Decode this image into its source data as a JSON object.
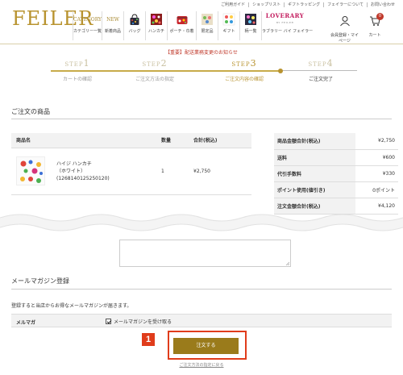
{
  "header": {
    "logo": "FEILER",
    "top_links": [
      "ご利用ガイド",
      "ショップリスト",
      "ギフトラッピング",
      "フェイラーについて",
      "お問い合わせ"
    ],
    "nav": [
      {
        "label": "カテゴリー一覧",
        "icon": "CATEGORY",
        "kind": "text"
      },
      {
        "label": "新着商品",
        "icon": "NEW",
        "kind": "text"
      },
      {
        "label": "バッグ",
        "icon": "bag-icon",
        "kind": "bag"
      },
      {
        "label": "ハンカチ",
        "icon": "handkerchief-icon",
        "kind": "hanky"
      },
      {
        "label": "ポーチ・巾着",
        "icon": "pouch-icon",
        "kind": "pouch"
      },
      {
        "label": "限定品",
        "icon": "limited-icon",
        "kind": "limited"
      },
      {
        "label": "ギフト",
        "icon": "gift-icon",
        "kind": "gift"
      },
      {
        "label": "柄一覧",
        "icon": "pattern-icon",
        "kind": "pattern"
      }
    ],
    "lovera": {
      "logo": "LOVERARY",
      "sub": "BY FEILER",
      "label": "ラブラリー バイ フェイラー"
    },
    "member_label": "会員登録・マイページ",
    "cart_label": "カート",
    "cart_count": "0"
  },
  "notice": "【重要】配送業務変更のお知らせ",
  "steps": [
    {
      "step": "STEP",
      "num": "1",
      "name": "カートの確認",
      "state": "done"
    },
    {
      "step": "STEP",
      "num": "2",
      "name": "ご注文方法の指定",
      "state": "done"
    },
    {
      "step": "STEP",
      "num": "3",
      "name": "ご注文内容の確認",
      "state": "active"
    },
    {
      "step": "STEP",
      "num": "4",
      "name": "ご注文完了",
      "state": "todo"
    }
  ],
  "order_items": {
    "title": "ご注文の商品",
    "headers": {
      "name": "商品名",
      "qty": "数量",
      "subtotal": "合計(税込)"
    },
    "item": {
      "name": "ハイジ ハンカチ",
      "color": "（ホワイト）",
      "code": "(1268140125250120)",
      "qty": "1",
      "subtotal": "¥2,750"
    }
  },
  "summary": [
    {
      "label": "商品金額合計(税込)",
      "value": "¥2,750"
    },
    {
      "label": "送料",
      "value": "¥600"
    },
    {
      "label": "代引手数料",
      "value": "¥330"
    },
    {
      "label": "ポイント使用(値引き)",
      "value": "0ポイント"
    },
    {
      "label": "注文金額合計(税込)",
      "value": "¥4,120"
    }
  ],
  "mail_magazine": {
    "title": "メールマガジン登録",
    "description": "登録すると当店からお得なメールマガジンが届きます。",
    "row_label": "メルマガ",
    "checkbox_label": "メールマガジンを受け取る",
    "checked": true
  },
  "order_button": "注文する",
  "marker": "1",
  "back_link": "ご注文方法の指定に戻る",
  "colors": {
    "gold": "#b8932f",
    "button": "#9a7b1b",
    "highlight": "#e03c1b",
    "notice": "#c0392b"
  }
}
